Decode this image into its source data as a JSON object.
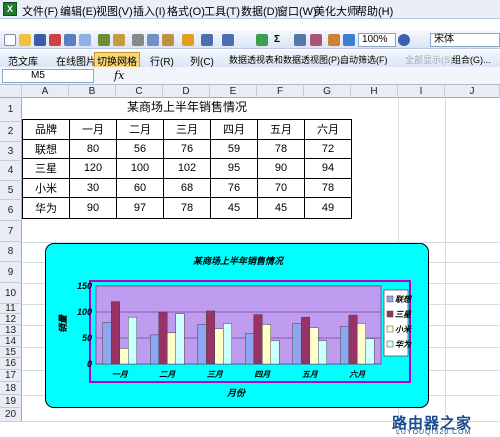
{
  "menu": [
    "文件(F)",
    "编辑(E)",
    "视图(V)",
    "插入(I)",
    "格式(O)",
    "工具(T)",
    "数据(D)",
    "窗口(W)",
    "美化大师",
    "帮助(H)"
  ],
  "toolbar1": {
    "zoom": "100%",
    "font": "宋体",
    "sigma": "Σ"
  },
  "toolbar2": {
    "items": [
      "范文库",
      "在线图片",
      "切换网格",
      "行(R)",
      "列(C)",
      "数据透视表和数据透视图(P)...",
      "自动筛选(F)",
      "全部显示(S)",
      "组合(G)..."
    ]
  },
  "formula": {
    "namebox": "M5",
    "fx": "fx",
    "value": ""
  },
  "columns": [
    "A",
    "B",
    "C",
    "D",
    "E",
    "F",
    "G",
    "H",
    "I",
    "J"
  ],
  "rows": [
    "1",
    "2",
    "3",
    "4",
    "5",
    "6",
    "7",
    "8",
    "9",
    "10",
    "11",
    "12",
    "13",
    "14",
    "15",
    "16",
    "17",
    "18",
    "19",
    "20"
  ],
  "table": {
    "title": "某商场上半年销售情况",
    "header": [
      "品牌",
      "一月",
      "二月",
      "三月",
      "四月",
      "五月",
      "六月"
    ],
    "rows": [
      [
        "联想",
        "80",
        "56",
        "76",
        "59",
        "78",
        "72"
      ],
      [
        "三星",
        "120",
        "100",
        "102",
        "95",
        "90",
        "94"
      ],
      [
        "小米",
        "30",
        "60",
        "68",
        "76",
        "70",
        "78"
      ],
      [
        "华为",
        "90",
        "97",
        "78",
        "45",
        "45",
        "49"
      ]
    ]
  },
  "chart_data": {
    "type": "bar",
    "title": "某商场上半年销售情况",
    "xlabel": "月份",
    "ylabel": "销量",
    "categories": [
      "一月",
      "二月",
      "三月",
      "四月",
      "五月",
      "六月"
    ],
    "series": [
      {
        "name": "联想",
        "values": [
          80,
          56,
          76,
          59,
          78,
          72
        ],
        "color": "#8ea6f0"
      },
      {
        "name": "三星",
        "values": [
          120,
          100,
          102,
          95,
          90,
          94
        ],
        "color": "#993366"
      },
      {
        "name": "小米",
        "values": [
          30,
          60,
          68,
          76,
          70,
          78
        ],
        "color": "#ffffcc"
      },
      {
        "name": "华为",
        "values": [
          90,
          97,
          78,
          45,
          45,
          49
        ],
        "color": "#ccffff"
      }
    ],
    "yticks": [
      0,
      50,
      100,
      150
    ],
    "ylim": [
      0,
      150
    ],
    "plot_bg": "#c09cf0",
    "chart_bg": "#00ffff",
    "frame_color": "#b000d0",
    "legend": "right",
    "grid": true
  },
  "watermark": {
    "text": "路由器之家",
    "url": "LUYOUQI520.COM"
  }
}
